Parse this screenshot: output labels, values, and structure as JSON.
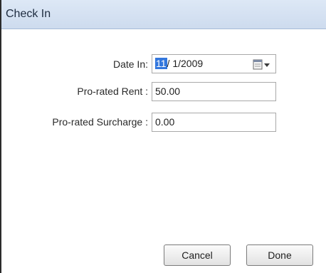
{
  "window": {
    "title": "Check In"
  },
  "form": {
    "date_in": {
      "label": "Date In:",
      "month": "11",
      "rest": "/  1/2009"
    },
    "prorated_rent": {
      "label": "Pro-rated Rent :",
      "value": "50.00"
    },
    "prorated_surcharge": {
      "label": "Pro-rated Surcharge :",
      "value": "0.00"
    }
  },
  "buttons": {
    "cancel": "Cancel",
    "done": "Done"
  },
  "icons": {
    "calendar": "calendar-dropdown-icon"
  }
}
